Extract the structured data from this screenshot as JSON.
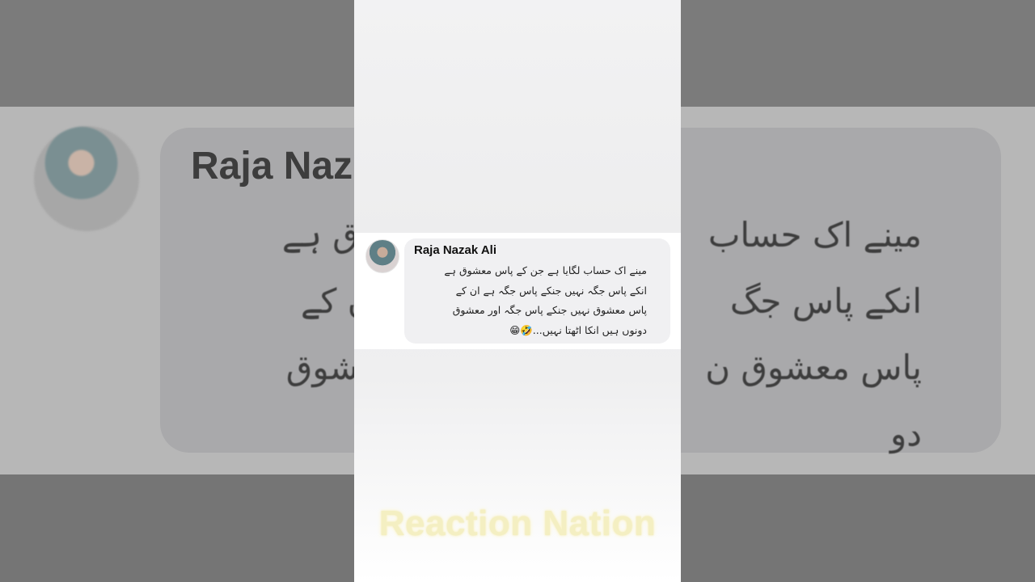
{
  "comment": {
    "author": "Raja Nazak Ali",
    "lines": [
      "مینے اک حساب لگایا ہے جن کے پاس معشوق ہے",
      "انکے پاس جگہ نہیں جنکے پاس جگہ ہے ان کے",
      "پاس معشوق نہیں جنکے پاس جگہ اور معشوق",
      "دونوں ہیں انکا اٹھتا نہیں...🤣😁"
    ]
  },
  "background_zoom": {
    "author_partial": "Raja Naz",
    "lines": [
      "مینے اک حساب",
      "انکے پاس جگ",
      "پاس معشوق ن",
      "دو"
    ],
    "lines_right": [
      "معشوق ہے",
      "ہ ہے ان کے",
      "ور معشوق",
      "..."
    ],
    "emoji": "😁🤣"
  },
  "watermark": "Reaction Nation"
}
